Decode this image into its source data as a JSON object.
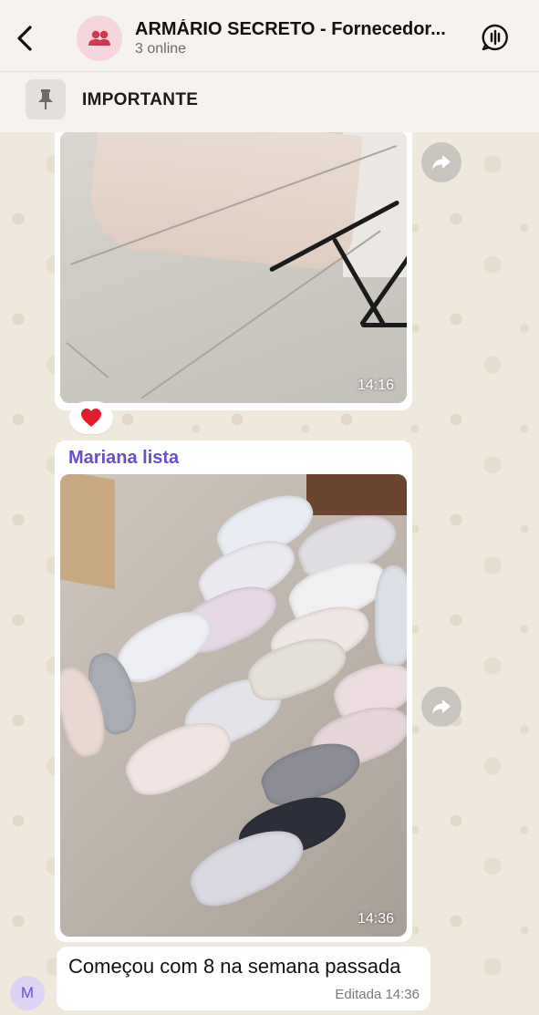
{
  "header": {
    "title": "ARMÁRIO SECRETO - Fornecedor...",
    "subtitle": "3 online",
    "back_icon": "chevron-left-icon",
    "group_icon": "group-people-icon",
    "voice_chat_icon": "voice-chat-icon"
  },
  "pinned": {
    "label": "IMPORTANTE",
    "icon": "pin-icon"
  },
  "messages": [
    {
      "type": "image",
      "time": "14:16",
      "reaction": "❤️"
    },
    {
      "type": "image",
      "sender": "Mariana lista",
      "time": "14:36"
    },
    {
      "type": "text",
      "text": "Começou com 8 na semana passada",
      "edited_label": "Editada",
      "time": "14:36",
      "avatar_initial": "M"
    }
  ],
  "colors": {
    "sender_name": "#6a4fc8",
    "group_avatar_bg": "#f6d6dc",
    "group_icon": "#d6344f",
    "sender_avatar_bg": "#ddd3f3"
  }
}
